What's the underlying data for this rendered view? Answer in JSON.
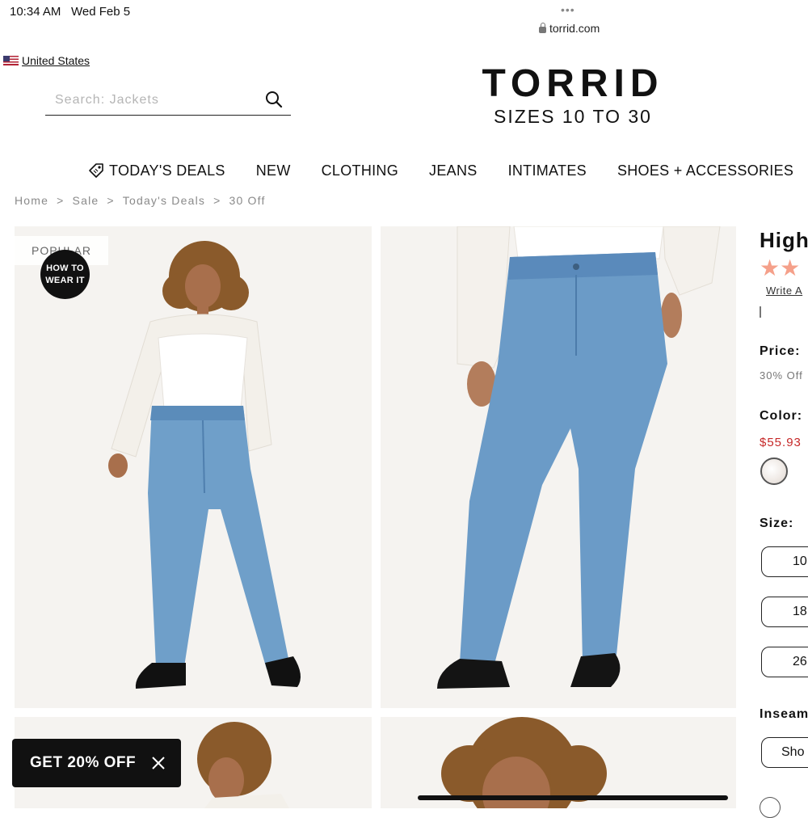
{
  "status_bar": {
    "time": "10:34 AM",
    "date": "Wed Feb 5",
    "dots": "•••",
    "url": "torrid.com"
  },
  "header": {
    "country": "United States",
    "search_placeholder": "Search: Jackets",
    "logo_main": "TORRID",
    "logo_sub": "SIZES 10 TO 30"
  },
  "nav": {
    "items": [
      {
        "label": "TODAY'S DEALS",
        "icon": "tag-icon"
      },
      {
        "label": "NEW"
      },
      {
        "label": "CLOTHING"
      },
      {
        "label": "JEANS"
      },
      {
        "label": "INTIMATES"
      },
      {
        "label": "SHOES + ACCESSORIES"
      }
    ]
  },
  "breadcrumb": [
    "Home",
    "Sale",
    "Today's Deals",
    "30 Off"
  ],
  "gallery": {
    "badge_popular": "POPULAR",
    "how_to_line1": "HOW TO",
    "how_to_line2": "WEAR IT"
  },
  "promo": {
    "label": "GET 20% OFF",
    "close_icon": "close-icon"
  },
  "product": {
    "title": "High",
    "rating_stars": "★★",
    "write_review": "Write A",
    "price_label": "Price:",
    "price_note": "30% Off",
    "color_label": "Color:",
    "sale_price": "$55.93",
    "size_label": "Size:",
    "sizes": [
      "10",
      "18",
      "26"
    ],
    "inseam_label": "Inseam",
    "inseam_option": "Sho"
  },
  "colors": {
    "sale": "#c62828",
    "stars": "#f5a08a",
    "denim": "#6f9fc9"
  }
}
